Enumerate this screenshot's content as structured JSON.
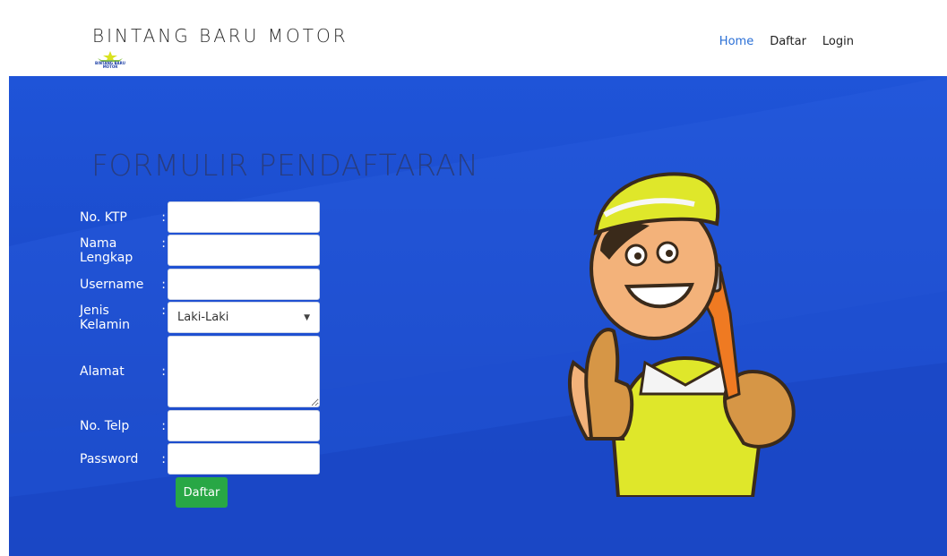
{
  "header": {
    "brand_title": "BINTANG BARU MOTOR",
    "logo_text": "BINTANG BARU MOTOR",
    "nav": [
      {
        "label": "Home",
        "active": true
      },
      {
        "label": "Daftar",
        "active": false
      },
      {
        "label": "Login",
        "active": false
      }
    ]
  },
  "hero": {
    "form_title": "FORMULIR PENDAFTARAN",
    "fields": {
      "ktp": {
        "label": "No. KTP",
        "value": ""
      },
      "nama": {
        "label": "Nama Lengkap",
        "value": ""
      },
      "username": {
        "label": "Username",
        "value": ""
      },
      "jenis_kelamin": {
        "label": "Jenis Kelamin",
        "value": "Laki-Laki"
      },
      "alamat": {
        "label": "Alamat",
        "value": ""
      },
      "telp": {
        "label": "No. Telp",
        "value": ""
      },
      "password": {
        "label": "Password",
        "value": ""
      }
    },
    "colon": ":",
    "submit_label": "Daftar"
  },
  "colors": {
    "hero_blue": "#1f54d8",
    "submit_green": "#28a745",
    "nav_active": "#2a6fd6"
  },
  "icons": [
    "star-logo-icon",
    "dropdown-caret-icon",
    "mechanic-illustration"
  ]
}
